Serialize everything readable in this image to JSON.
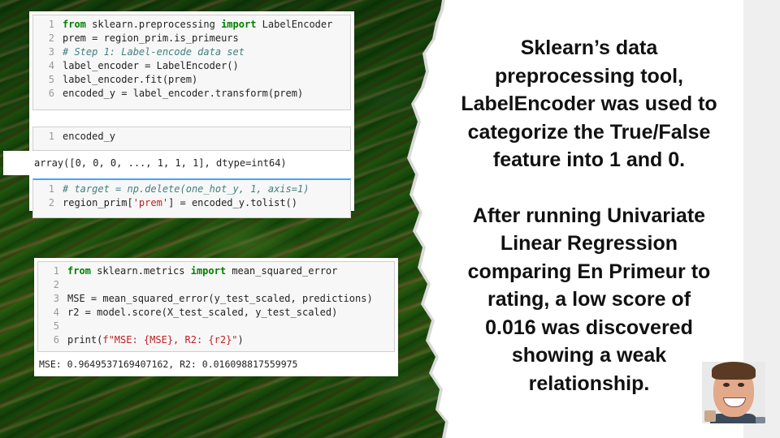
{
  "code_cell_1": {
    "lines": [
      {
        "n": "1",
        "parts": [
          {
            "c": "kw",
            "t": "from"
          },
          {
            "c": "code",
            "t": " sklearn.preprocessing "
          },
          {
            "c": "kw",
            "t": "import"
          },
          {
            "c": "code",
            "t": " LabelEncoder"
          }
        ]
      },
      {
        "n": "2",
        "parts": [
          {
            "c": "code",
            "t": "prem = region_prim.is_primeurs"
          }
        ]
      },
      {
        "n": "3",
        "parts": [
          {
            "c": "cm",
            "t": "# Step 1: Label-encode data set"
          }
        ]
      },
      {
        "n": "4",
        "parts": [
          {
            "c": "code",
            "t": "label_encoder = LabelEncoder()"
          }
        ]
      },
      {
        "n": "5",
        "parts": [
          {
            "c": "code",
            "t": "label_encoder.fit(prem)"
          }
        ]
      },
      {
        "n": "6",
        "parts": [
          {
            "c": "code",
            "t": "encoded_y = label_encoder.transform(prem)"
          }
        ]
      }
    ]
  },
  "code_cell_2": {
    "lines": [
      {
        "n": "1",
        "parts": [
          {
            "c": "code",
            "t": "encoded_y"
          }
        ]
      }
    ],
    "output": "array([0, 0, 0, ..., 1, 1, 1], dtype=int64)"
  },
  "code_cell_3": {
    "lines": [
      {
        "n": "1",
        "parts": [
          {
            "c": "cm",
            "t": "# target = np.delete(one_hot_y, 1, axis=1)"
          }
        ]
      },
      {
        "n": "2",
        "parts": [
          {
            "c": "code",
            "t": "region_prim["
          },
          {
            "c": "st",
            "t": "'prem'"
          },
          {
            "c": "code",
            "t": "] = encoded_y.tolist()"
          }
        ]
      }
    ]
  },
  "code_cell_4": {
    "lines": [
      {
        "n": "1",
        "parts": [
          {
            "c": "kw",
            "t": "from"
          },
          {
            "c": "code",
            "t": " sklearn.metrics "
          },
          {
            "c": "kw",
            "t": "import"
          },
          {
            "c": "code",
            "t": " mean_squared_error"
          }
        ]
      },
      {
        "n": "2",
        "parts": [
          {
            "c": "code",
            "t": ""
          }
        ]
      },
      {
        "n": "3",
        "parts": [
          {
            "c": "code",
            "t": "MSE = mean_squared_error(y_test_scaled, predictions)"
          }
        ]
      },
      {
        "n": "4",
        "parts": [
          {
            "c": "code",
            "t": "r2 = model.score(X_test_scaled, y_test_scaled)"
          }
        ]
      },
      {
        "n": "5",
        "parts": [
          {
            "c": "code",
            "t": ""
          }
        ]
      },
      {
        "n": "6",
        "parts": [
          {
            "c": "code",
            "t": "print("
          },
          {
            "c": "st",
            "t": "f\"MSE: {MSE}, R2: {r2}\""
          },
          {
            "c": "code",
            "t": ")"
          }
        ]
      }
    ],
    "output": "MSE: 0.9649537169407162, R2: 0.016098817559975"
  },
  "slide_text": {
    "paragraph_1": "Sklearn’s data preprocessing tool, LabelEncoder was used to categorize the True/False feature into 1 and 0.",
    "paragraph_2": "After running Univariate Linear Regression comparing En Primeur to rating, a low score of 0.016 was discovered showing a weak relationship."
  },
  "colors": {
    "keyword": "#008000",
    "comment": "#408080",
    "string": "#ba2121",
    "selected_cell": "#42a5f5"
  },
  "icons": {
    "presenter": "presenter-avatar-icon"
  }
}
